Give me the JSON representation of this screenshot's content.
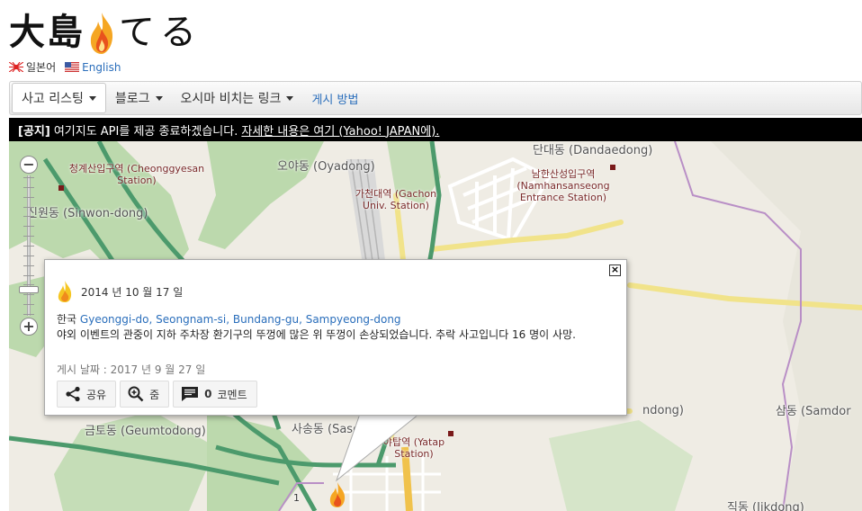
{
  "header": {
    "logo_kanji": "大島",
    "logo_kana": "てる",
    "languages": [
      {
        "label": "일본어",
        "flag": "jp"
      },
      {
        "label": "English",
        "flag": "us"
      }
    ]
  },
  "nav": {
    "items": [
      {
        "label": "사고 리스팅",
        "dropdown": true
      },
      {
        "label": "블로그",
        "dropdown": true
      },
      {
        "label": "오시마 비치는 링크",
        "dropdown": true
      },
      {
        "label": "게시 방법",
        "dropdown": false
      }
    ]
  },
  "notice": {
    "tag": "[공지]",
    "text": "여기지도 API를 제공 종료하겠습니다.",
    "link": "자세한 내용은 여기 (Yahoo! JAPAN에)."
  },
  "map": {
    "labels": {
      "cheonggyesan": "청계산입구역 (Cheonggyesan Station)",
      "oyadong": "오야동 (Oyadong)",
      "dandaedong": "단대동 (Dandaedong)",
      "sinwon": "신원동 (Sinwon-dong)",
      "gachon": "가천대역 (Gachon Univ. Station)",
      "namhansanseong": "남한산성입구역 (Namhansanseong Entrance Station)",
      "geumtodong": "금토동 (Geumtodong)",
      "sasong": "사송동 (Sasong)",
      "yatap": "야탑역 (Yatap Station)",
      "ndong": "ndong)",
      "samdong": "삼동 (Samdor",
      "jikdong": "직동 (Jikdong)",
      "road_num": "1"
    },
    "zoom_level_fraction": 0.18
  },
  "popup": {
    "date": "2014 년 10 월 17 일",
    "country": "한국",
    "location": "Gyeonggi-do, Seongnam-si, Bundang-gu, Sampyeong-dong",
    "description": "야외 이벤트의 관중이 지하 주차장 환기구의 뚜껑에 많은 위 뚜껑이 손상되었습니다. 추락 사고입니다 16 명이 사망.",
    "posted": "게시 날짜 : 2017 년 9 월 27 일",
    "close": "×",
    "actions": {
      "share": "공유",
      "zoom": "줌",
      "comment_count": "0",
      "comment": "코멘트"
    }
  },
  "colors": {
    "map_bg": "#efece4",
    "green_road": "#4c9a6c",
    "yellow_road": "#f1e38a",
    "forest": "#b7d7a8",
    "link": "#2a6ebb",
    "boundary": "#b98fc6"
  }
}
